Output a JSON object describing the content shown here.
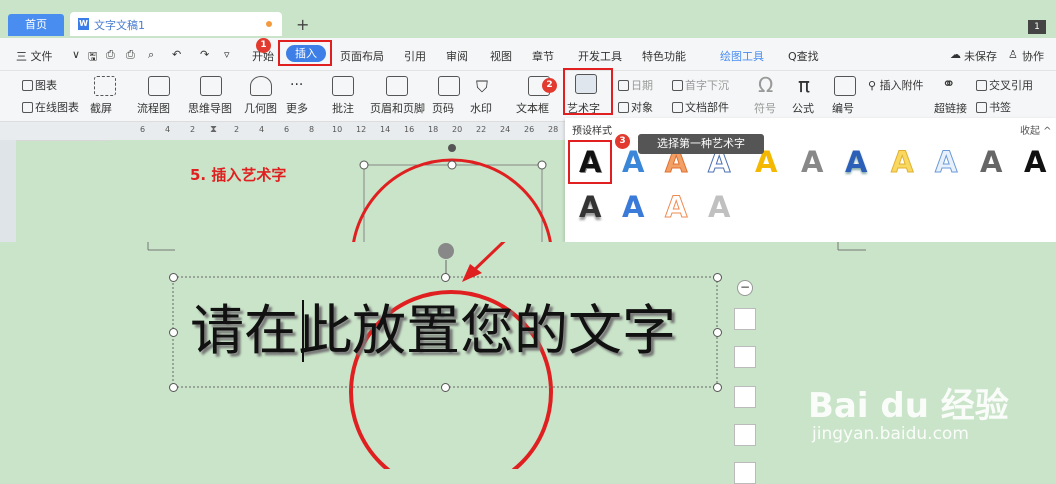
{
  "tabs": {
    "home": "首页",
    "doc": "文字文稿1",
    "page_indicator": "1"
  },
  "menu": {
    "file": "三 文件",
    "start": "开始",
    "insert": "插入",
    "layout": "页面布局",
    "reference": "引用",
    "review": "审阅",
    "view": "视图",
    "section": "章节",
    "devtools": "开发工具",
    "features": "特色功能",
    "drawtools": "绘图工具",
    "find": "Q查找",
    "unsaved": "未保存",
    "collab": "协作"
  },
  "ribbon": {
    "chart": "图表",
    "online_chart": "在线图表",
    "screenshot": "截屏",
    "flowchart": "流程图",
    "mindmap": "思维导图",
    "geometry": "几何图",
    "more": "更多",
    "comment": "批注",
    "header_footer": "页眉和页脚",
    "page_number": "页码",
    "watermark": "水印",
    "textbox": "文本框",
    "wordart": "艺术字",
    "date": "日期",
    "dropcap": "首字下沉",
    "object": "对象",
    "doc_parts": "文档部件",
    "symbol": "符号",
    "formula": "公式",
    "numbering": "编号",
    "attachment": "插入附件",
    "hyperlink": "超链接",
    "crossref": "交叉引用",
    "bookmark": "书签"
  },
  "ruler_ticks": [
    "6",
    "4",
    "2",
    "2",
    "4",
    "6",
    "8",
    "10",
    "12",
    "14",
    "16",
    "18",
    "20",
    "22",
    "24",
    "26",
    "28"
  ],
  "panel": {
    "section_title": "预设样式",
    "collapse": "收起",
    "tooltip": "选择第一种艺术字",
    "letter": "A"
  },
  "annotations": {
    "step5": "5. 插入艺术字",
    "b1": "1",
    "b2": "2",
    "b3": "3"
  },
  "doc": {
    "placeholder_text": "请在此放置您的文字"
  },
  "watermark": {
    "brand": "Bai du 经验",
    "url": "jingyan.baidu.com"
  },
  "colors": {
    "accent": "#4a8df0",
    "annotation_red": "#e02020",
    "background": "#c9e4c8"
  }
}
